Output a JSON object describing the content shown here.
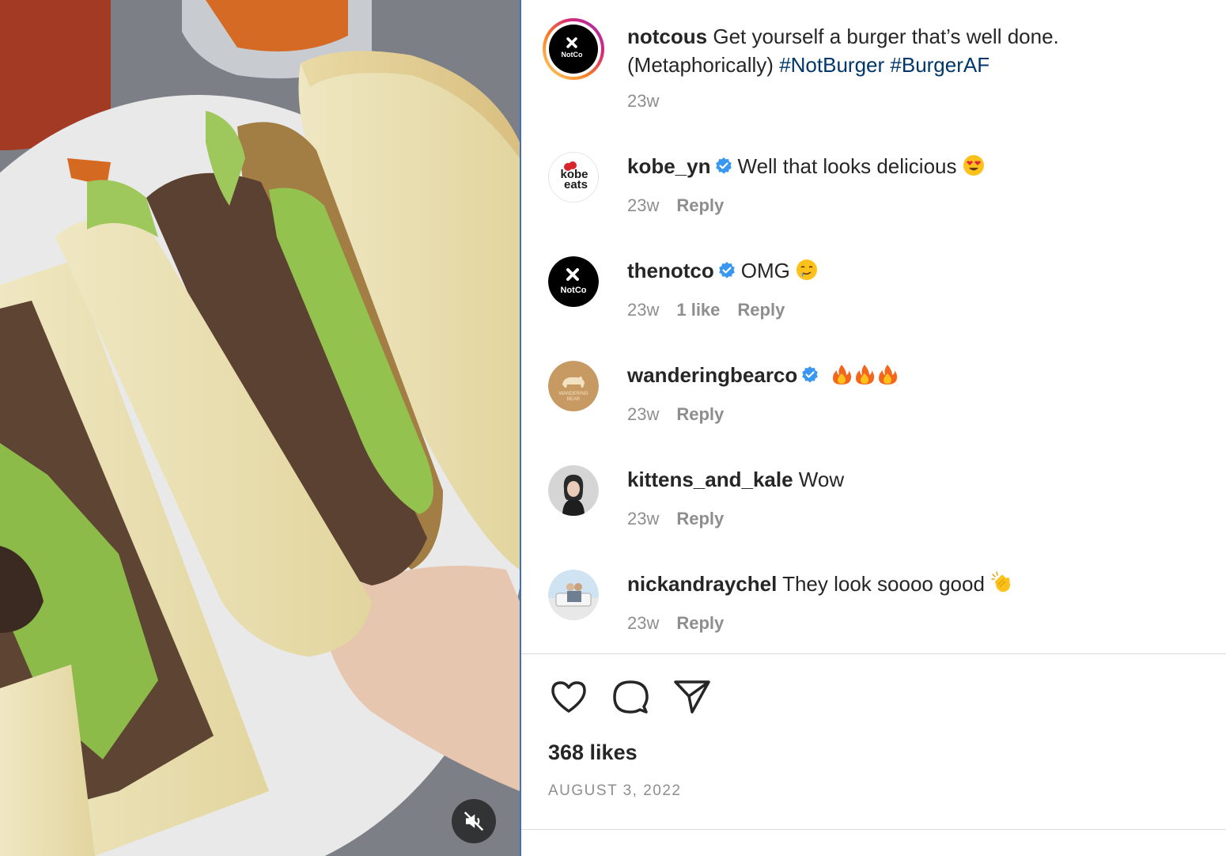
{
  "post": {
    "author": "notcous",
    "caption_text": "Get yourself a burger that’s well done. (Metaphorically)",
    "hashtags": [
      "#NotBurger",
      "#BurgerAF"
    ],
    "time": "23w",
    "logo_text": "NotCo"
  },
  "comments": [
    {
      "user": "kobe_yn",
      "verified": true,
      "text": "Well that looks delicious",
      "emoji": "smiling-face-heart-eyes",
      "time": "23w",
      "likes": "",
      "reply": "Reply",
      "avatar_text": "kobe eats"
    },
    {
      "user": "thenotco",
      "verified": true,
      "text": "OMG",
      "emoji": "drooling-face",
      "time": "23w",
      "likes": "1 like",
      "reply": "Reply",
      "avatar_text": "NotCo"
    },
    {
      "user": "wanderingbearco",
      "verified": true,
      "text": "",
      "emoji": "fire-x3",
      "time": "23w",
      "likes": "",
      "reply": "Reply",
      "avatar_text": "WANDERING BEAR"
    },
    {
      "user": "kittens_and_kale",
      "verified": false,
      "text": "Wow",
      "emoji": "",
      "time": "23w",
      "likes": "",
      "reply": "Reply",
      "avatar_text": ""
    },
    {
      "user": "nickandraychel",
      "verified": false,
      "text": "They look soooo good",
      "emoji": "clapping-hands",
      "time": "23w",
      "likes": "",
      "reply": "Reply",
      "avatar_text": ""
    }
  ],
  "footer": {
    "likes_count": "368 likes",
    "date": "AUGUST 3, 2022"
  },
  "colors": {
    "hashtag": "#00376b",
    "verified": "#3897f0",
    "muted_text": "#8e8e8e",
    "divider_accent": "#3d6fc2"
  }
}
